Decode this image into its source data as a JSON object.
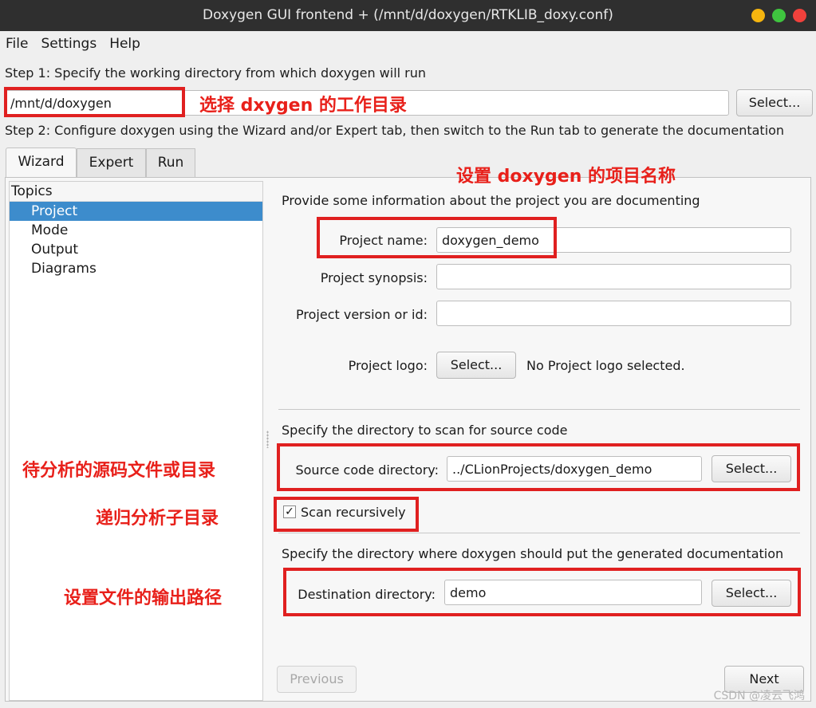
{
  "window": {
    "title": "Doxygen GUI frontend + (/mnt/d/doxygen/RTKLIB_doxy.conf)",
    "buttons": {
      "minimize_color": "#f5b50f",
      "maximize_color": "#3fc43f",
      "close_color": "#f1413c"
    }
  },
  "menu": {
    "file": "File",
    "settings": "Settings",
    "help": "Help"
  },
  "step1": {
    "text": "Step 1: Specify the working directory from which doxygen will run",
    "working_dir": "/mnt/d/doxygen",
    "select_label": "Select..."
  },
  "step2": {
    "text": "Step 2: Configure doxygen using the Wizard and/or Expert tab, then switch to the Run tab to generate the documentation"
  },
  "tabs": {
    "wizard": "Wizard",
    "expert": "Expert",
    "run": "Run",
    "active": "Wizard"
  },
  "topics": {
    "header": "Topics",
    "items": [
      "Project",
      "Mode",
      "Output",
      "Diagrams"
    ],
    "selected": "Project"
  },
  "project": {
    "intro": "Provide some information about the project you are documenting",
    "name_label": "Project name:",
    "name_value": "doxygen_demo",
    "synopsis_label": "Project synopsis:",
    "synopsis_value": "",
    "version_label": "Project version or id:",
    "version_value": "",
    "logo_label": "Project logo:",
    "logo_select": "Select...",
    "logo_status": "No Project logo selected."
  },
  "source": {
    "title": "Specify the directory to scan for source code",
    "label": "Source code directory:",
    "value": "../CLionProjects/doxygen_demo",
    "select_label": "Select...",
    "recursive_label": "Scan recursively",
    "recursive_checked": true,
    "check_glyph": "✓"
  },
  "destination": {
    "title": "Specify the directory where doxygen should put the generated documentation",
    "label": "Destination directory:",
    "value": "demo",
    "select_label": "Select..."
  },
  "nav": {
    "previous": "Previous",
    "next": "Next"
  },
  "annotations": {
    "working_dir": "选择 dxygen 的工作目录",
    "project_name": "设置 doxygen 的项目名称",
    "source_dir": "待分析的源码文件或目录",
    "recursive": "递归分析子目录",
    "output_dir": "设置文件的输出路径",
    "color": "#e02020"
  },
  "watermark": "CSDN @凌云飞鸿"
}
